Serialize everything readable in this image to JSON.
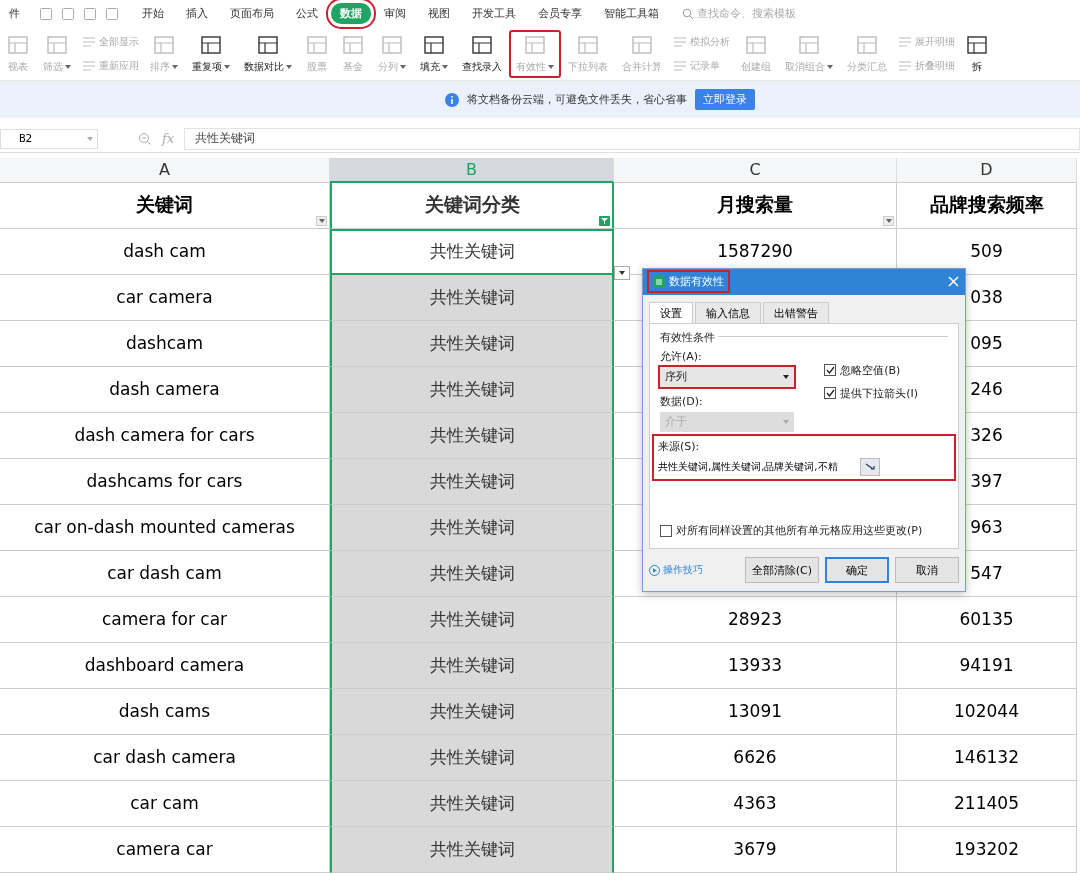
{
  "menu_tabs": [
    {
      "label": "件",
      "selected": false,
      "highlighted": false
    },
    {
      "label": "开始",
      "selected": false,
      "highlighted": false
    },
    {
      "label": "插入",
      "selected": false,
      "highlighted": false
    },
    {
      "label": "页面布局",
      "selected": false,
      "highlighted": false
    },
    {
      "label": "公式",
      "selected": false,
      "highlighted": false
    },
    {
      "label": "数据",
      "selected": true,
      "highlighted": true
    },
    {
      "label": "审阅",
      "selected": false,
      "highlighted": false
    },
    {
      "label": "视图",
      "selected": false,
      "highlighted": false
    },
    {
      "label": "开发工具",
      "selected": false,
      "highlighted": false
    },
    {
      "label": "会员专享",
      "selected": false,
      "highlighted": false
    },
    {
      "label": "智能工具箱",
      "selected": false,
      "highlighted": false
    }
  ],
  "command_search": {
    "placeholder": "查找命令、搜索模板"
  },
  "toolbar": [
    {
      "kind": "large",
      "label": "视表",
      "disabled": true,
      "dropdown": false,
      "highlighted": false
    },
    {
      "kind": "large",
      "label": "筛选",
      "disabled": true,
      "dropdown": true,
      "highlighted": false
    },
    {
      "kind": "stack",
      "items": [
        {
          "label": "全部显示",
          "disabled": true
        },
        {
          "label": "重新应用",
          "disabled": true
        }
      ]
    },
    {
      "kind": "large",
      "label": "排序",
      "disabled": true,
      "dropdown": true,
      "highlighted": false
    },
    {
      "kind": "large",
      "label": "重复项",
      "disabled": false,
      "dropdown": true,
      "highlighted": false
    },
    {
      "kind": "large",
      "label": "数据对比",
      "disabled": false,
      "dropdown": true,
      "highlighted": false
    },
    {
      "kind": "large",
      "label": "股票",
      "disabled": true,
      "dropdown": false,
      "highlighted": false
    },
    {
      "kind": "large",
      "label": "基金",
      "disabled": true,
      "dropdown": false,
      "highlighted": false
    },
    {
      "kind": "large",
      "label": "分列",
      "disabled": true,
      "dropdown": true,
      "highlighted": false
    },
    {
      "kind": "large",
      "label": "填充",
      "disabled": false,
      "dropdown": true,
      "highlighted": false
    },
    {
      "kind": "large",
      "label": "查找录入",
      "disabled": false,
      "dropdown": false,
      "highlighted": false
    },
    {
      "kind": "large",
      "label": "有效性",
      "disabled": true,
      "dropdown": true,
      "highlighted": true
    },
    {
      "kind": "large",
      "label": "下拉列表",
      "disabled": true,
      "dropdown": false,
      "highlighted": false
    },
    {
      "kind": "large",
      "label": "合并计算",
      "disabled": true,
      "dropdown": false,
      "highlighted": false
    },
    {
      "kind": "stack",
      "items": [
        {
          "label": "模拟分析",
          "disabled": true
        },
        {
          "label": "记录单",
          "disabled": true
        }
      ]
    },
    {
      "kind": "large",
      "label": "创建组",
      "disabled": true,
      "dropdown": false,
      "highlighted": false
    },
    {
      "kind": "large",
      "label": "取消组合",
      "disabled": true,
      "dropdown": true,
      "highlighted": false
    },
    {
      "kind": "large",
      "label": "分类汇总",
      "disabled": true,
      "dropdown": false,
      "highlighted": false
    },
    {
      "kind": "stack",
      "items": [
        {
          "label": "展开明细",
          "disabled": true
        },
        {
          "label": "折叠明细",
          "disabled": true
        }
      ]
    },
    {
      "kind": "large",
      "label": "拆",
      "disabled": false,
      "dropdown": false,
      "highlighted": false
    }
  ],
  "banner": {
    "message": "将文档备份云端，可避免文件丢失，省心省事",
    "button": "立即登录"
  },
  "formula_bar": {
    "cell": "B2",
    "fx": "fx",
    "value": "共性关键词"
  },
  "columns": [
    {
      "letter": "A",
      "selected": false
    },
    {
      "letter": "B",
      "selected": true
    },
    {
      "letter": "C",
      "selected": false
    },
    {
      "letter": "D",
      "selected": false
    }
  ],
  "header_row": [
    {
      "text": "关键词",
      "filter_button": true,
      "filtered": false
    },
    {
      "text": "关键词分类",
      "filter_button": true,
      "filtered": true
    },
    {
      "text": "月搜索量",
      "filter_button": true,
      "filtered": false
    },
    {
      "text": "品牌搜索频率"
    }
  ],
  "rows": [
    {
      "cells": [
        "dash cam",
        "共性关键词",
        "1587290",
        "509"
      ],
      "active": true
    },
    {
      "cells": [
        "car camera",
        "共性关键词",
        "",
        "038"
      ],
      "active": false
    },
    {
      "cells": [
        "dashcam",
        "共性关键词",
        "",
        "095"
      ],
      "active": false
    },
    {
      "cells": [
        "dash camera",
        "共性关键词",
        "",
        "246"
      ],
      "active": false
    },
    {
      "cells": [
        "dash camera for cars",
        "共性关键词",
        "",
        "326"
      ],
      "active": false
    },
    {
      "cells": [
        "dashcams for cars",
        "共性关键词",
        "",
        "397"
      ],
      "active": false
    },
    {
      "cells": [
        "car on-dash mounted cameras",
        "共性关键词",
        "",
        "963"
      ],
      "active": false
    },
    {
      "cells": [
        "car dash cam",
        "共性关键词",
        "",
        "547"
      ],
      "active": false
    },
    {
      "cells": [
        "camera for car",
        "共性关键词",
        "28923",
        "60135"
      ],
      "active": false
    },
    {
      "cells": [
        "dashboard camera",
        "共性关键词",
        "13933",
        "94191"
      ],
      "active": false
    },
    {
      "cells": [
        "dash cams",
        "共性关键词",
        "13091",
        "102044"
      ],
      "active": false
    },
    {
      "cells": [
        "car dash camera",
        "共性关键词",
        "6626",
        "146132"
      ],
      "active": false
    },
    {
      "cells": [
        "car cam",
        "共性关键词",
        "4363",
        "211405"
      ],
      "active": false
    },
    {
      "cells": [
        "camera car",
        "共性关键词",
        "3679",
        "193202"
      ],
      "active": false
    }
  ],
  "dialog": {
    "title": "数据有效性",
    "title_highlighted": true,
    "tabs": [
      {
        "label": "设置",
        "selected": true
      },
      {
        "label": "输入信息",
        "selected": false
      },
      {
        "label": "出错警告",
        "selected": false
      }
    ],
    "section": "有效性条件",
    "allow": {
      "label": "允许(A):",
      "value": "序列",
      "highlighted": true,
      "disabled": false
    },
    "data": {
      "label": "数据(D):",
      "value": "介于",
      "disabled": true
    },
    "checks": [
      {
        "label": "忽略空值(B)",
        "checked": true
      },
      {
        "label": "提供下拉箭头(I)",
        "checked": true
      }
    ],
    "source": {
      "label": "来源(S):",
      "value": "共性关键词,属性关键词,品牌关键词,不精",
      "highlighted": true
    },
    "apply_all": {
      "label": "对所有同样设置的其他所有单元格应用这些更改(P)",
      "checked": false
    },
    "tips_link": "操作技巧",
    "buttons": [
      {
        "label": "全部清除(C)",
        "default": false
      },
      {
        "label": "确定",
        "default": true
      },
      {
        "label": "取消",
        "default": false
      }
    ]
  }
}
